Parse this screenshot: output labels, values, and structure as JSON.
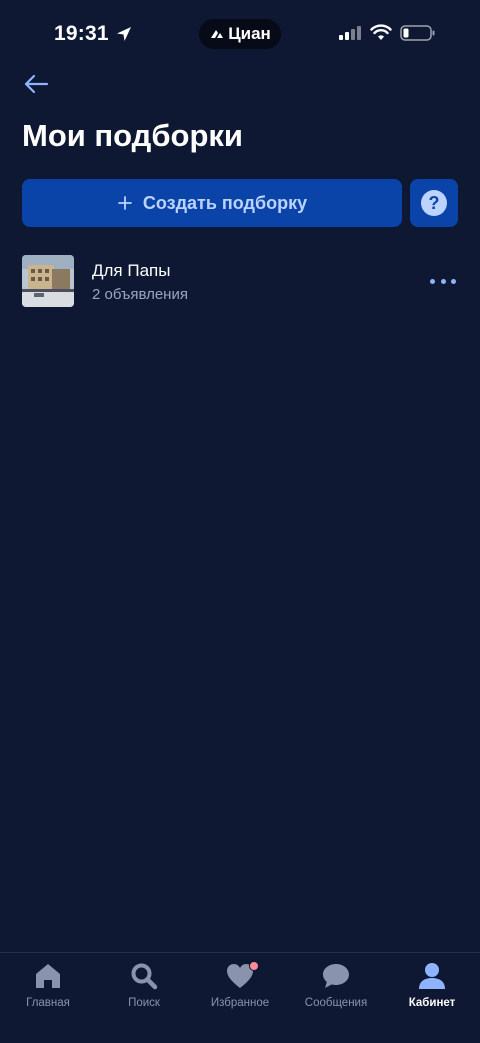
{
  "status_bar": {
    "time": "19:31",
    "island_label": "Циан"
  },
  "header": {
    "back_icon": "arrow-left-icon",
    "title": "Мои подборки"
  },
  "actions": {
    "create_label": "Создать подборку",
    "help_icon": "question-icon"
  },
  "collections": [
    {
      "title": "Для Папы",
      "subtitle": "2 объявления"
    }
  ],
  "tab_bar": {
    "items": [
      {
        "label": "Главная",
        "icon": "home-icon"
      },
      {
        "label": "Поиск",
        "icon": "search-icon"
      },
      {
        "label": "Избранное",
        "icon": "heart-icon"
      },
      {
        "label": "Сообщения",
        "icon": "chat-icon"
      },
      {
        "label": "Кабинет",
        "icon": "profile-icon"
      }
    ],
    "active_index": 4
  },
  "colors": {
    "background": "#0f1833",
    "button_bg": "#0a44a8",
    "button_text": "#bcd3ff",
    "accent": "#8fb4ff",
    "badge": "#ff8a9a"
  }
}
